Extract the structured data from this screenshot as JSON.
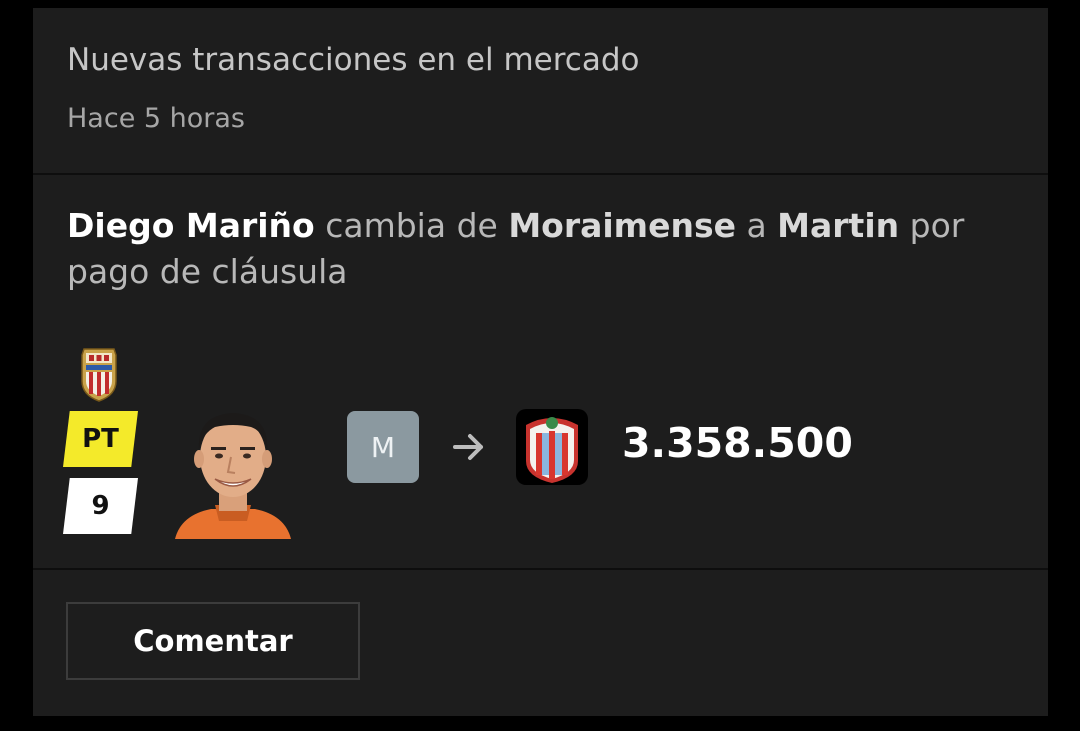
{
  "notification": {
    "title": "Nuevas transacciones en el mercado",
    "time_ago": "Hace 5 horas"
  },
  "transfer": {
    "player_name": "Diego Mariño",
    "text_1": " cambia de ",
    "from_team": "Moraimense",
    "text_2": " a ",
    "to_team": "Martin",
    "text_3": " por pago de cláusula",
    "position": "PT",
    "points": "9",
    "from_badge_letter": "M",
    "price": "3.358.500",
    "player_team_crest_icon": "almeria-crest-icon",
    "destination_crest_icon": "club-crest-icon",
    "arrow_icon": "arrow-right-icon",
    "colors": {
      "position_badge": "#f4ea2a",
      "points_badge": "#ffffff",
      "from_badge": "#8b99a0"
    }
  },
  "actions": {
    "comment_label": "Comentar"
  }
}
